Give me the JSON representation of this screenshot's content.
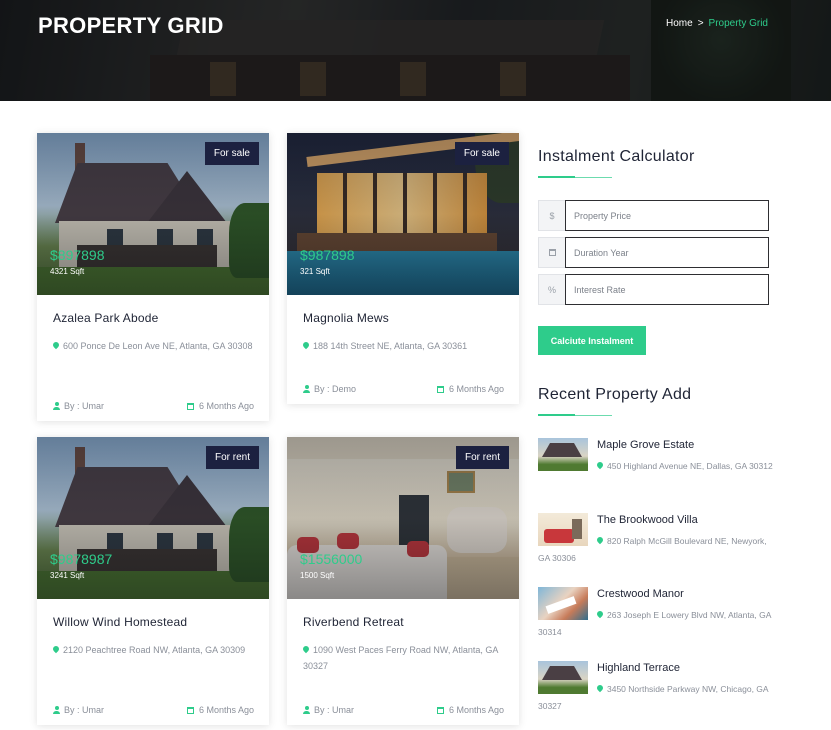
{
  "header": {
    "title": "PROPERTY GRID",
    "breadcrumb": {
      "home": "Home",
      "separator": ">",
      "current": "Property Grid"
    }
  },
  "listings": [
    {
      "badge": "For sale",
      "price": "$897898",
      "area": "4321 Sqft",
      "name": "Azalea Park Abode",
      "address": "600 Ponce De Leon Ave NE, Atlanta, GA 30308",
      "author": "By : Umar",
      "posted": "6 Months Ago"
    },
    {
      "badge": "For sale",
      "price": "$987898",
      "area": "321 Sqft",
      "name": "Magnolia Mews",
      "address": "188 14th Street NE, Atlanta, GA 30361",
      "author": "By : Demo",
      "posted": "6 Months Ago"
    },
    {
      "badge": "For rent",
      "price": "$9878987",
      "area": "3241 Sqft",
      "name": "Willow Wind Homestead",
      "address": "2120 Peachtree Road NW, Atlanta, GA 30309",
      "author": "By : Umar",
      "posted": "6 Months Ago"
    },
    {
      "badge": "For rent",
      "price": "$1556000",
      "area": "1500 Sqft",
      "name": "Riverbend Retreat",
      "address": "1090 West Paces Ferry Road NW, Atlanta, GA 30327",
      "author": "By : Umar",
      "posted": "6 Months Ago"
    }
  ],
  "calculator": {
    "title": "Instalment Calculator",
    "fields": [
      {
        "prefix": "$",
        "placeholder": "Property Price"
      },
      {
        "prefix": "cal",
        "placeholder": "Duration Year"
      },
      {
        "prefix": "%",
        "placeholder": "Interest Rate"
      }
    ],
    "button": "Calciute Instalment"
  },
  "recent": {
    "title": "Recent Property Add",
    "items": [
      {
        "name": "Maple Grove Estate",
        "address": "450 Highland Avenue NE, Dallas, GA 30312"
      },
      {
        "name": "The Brookwood Villa",
        "address": "820 Ralph McGill Boulevard NE, Newyork, GA 30306"
      },
      {
        "name": "Crestwood Manor",
        "address": "263 Joseph E Lowery Blvd NW, Atlanta, GA 30314"
      },
      {
        "name": "Highland Terrace",
        "address": "3450 Northside Parkway NW, Chicago, GA 30327"
      }
    ]
  },
  "colors": {
    "accent": "#2ecc8b",
    "badge_bg": "#1c2140",
    "heading": "#1f2435",
    "muted": "#8a8f99"
  }
}
